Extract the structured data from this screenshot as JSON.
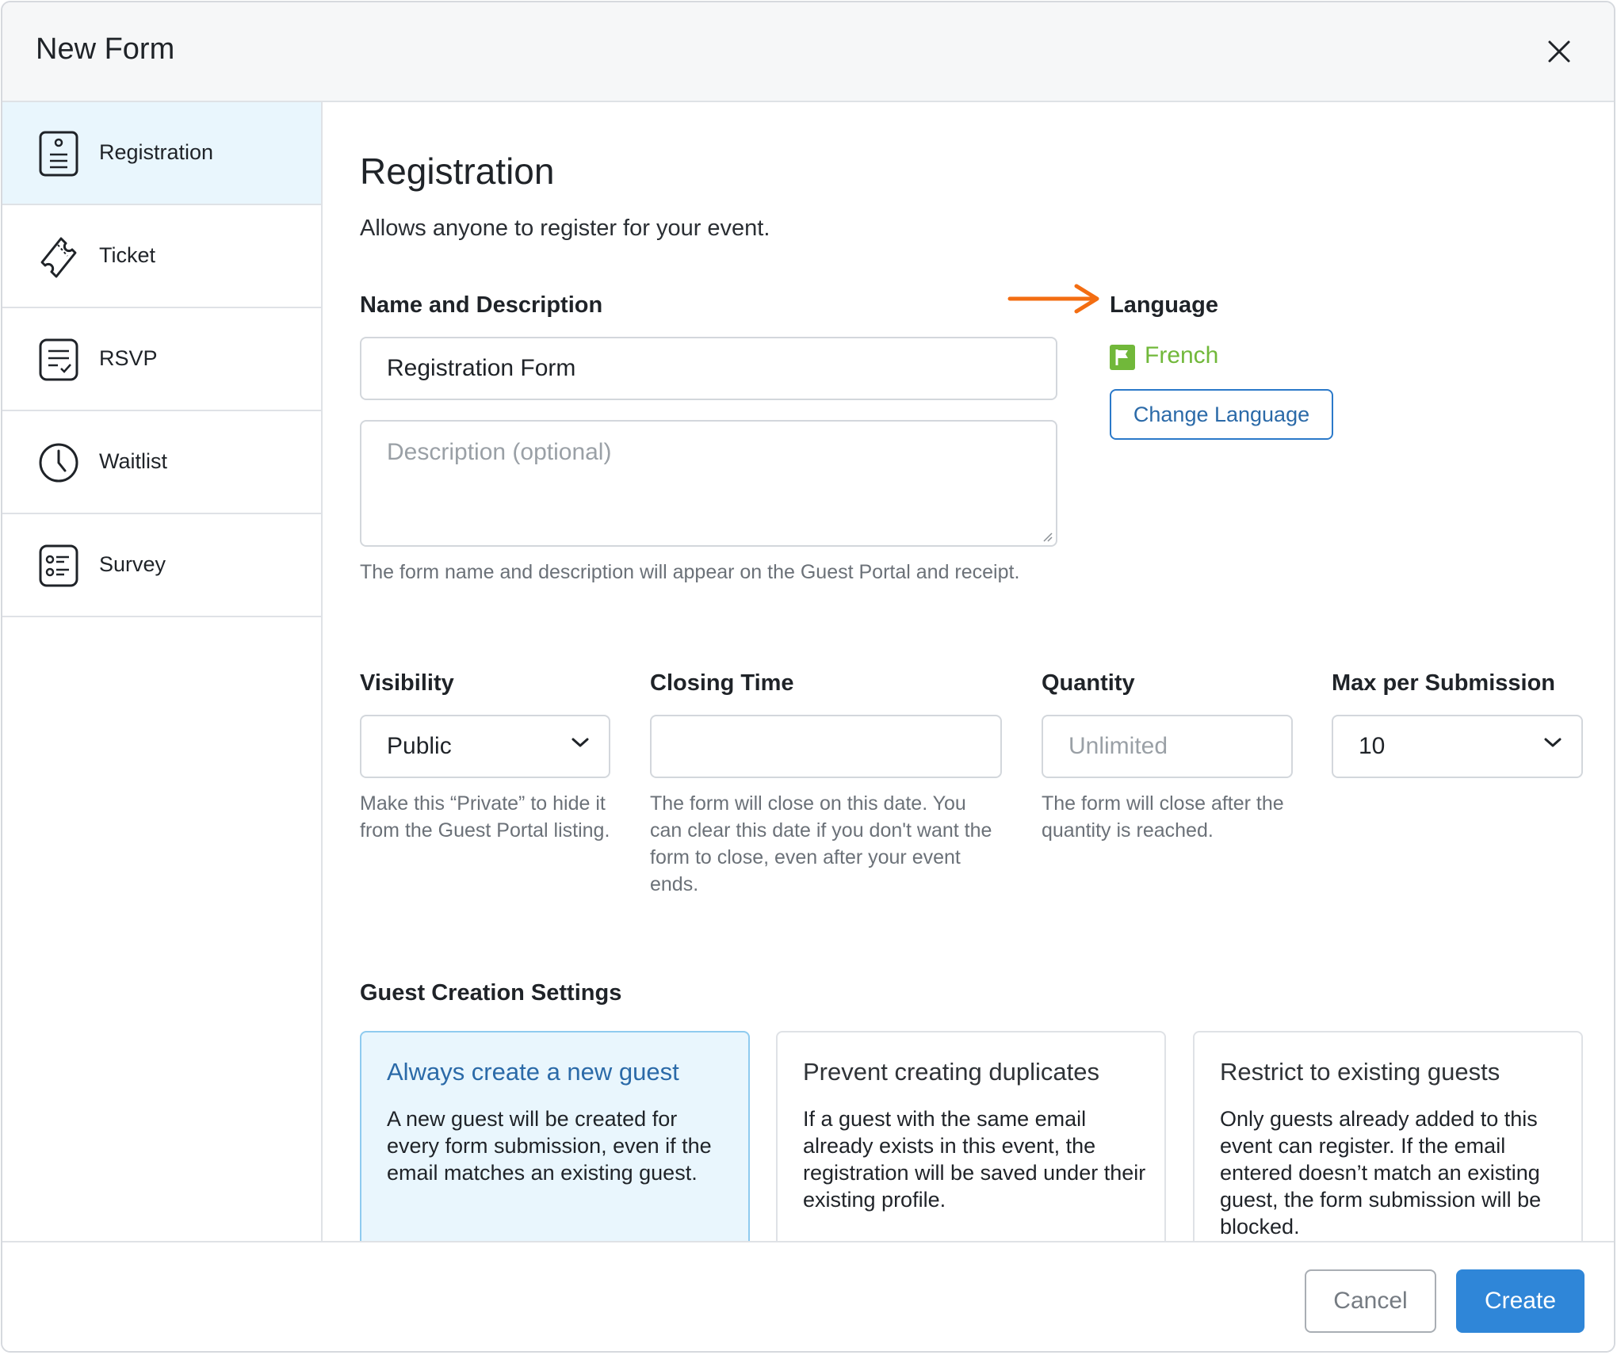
{
  "dialog": {
    "title": "New Form"
  },
  "sidebar": {
    "items": [
      {
        "label": "Registration",
        "icon": "registration-form-icon",
        "active": true
      },
      {
        "label": "Ticket",
        "icon": "ticket-icon",
        "active": false
      },
      {
        "label": "RSVP",
        "icon": "rsvp-checklist-icon",
        "active": false
      },
      {
        "label": "Waitlist",
        "icon": "clock-icon",
        "active": false
      },
      {
        "label": "Survey",
        "icon": "survey-list-icon",
        "active": false
      }
    ]
  },
  "main": {
    "title": "Registration",
    "subtitle": "Allows anyone to register for your event.",
    "name_desc": {
      "label": "Name and Description",
      "name_value": "Registration Form",
      "description_placeholder": "Description (optional)",
      "help": "The form name and description will appear on the Guest Portal and receipt."
    },
    "language": {
      "label": "Language",
      "value": "French",
      "change_button": "Change Language"
    },
    "visibility": {
      "label": "Visibility",
      "value": "Public",
      "help": "Make this “Private” to hide it from the Guest Portal listing."
    },
    "closing_time": {
      "label": "Closing Time",
      "value": "",
      "help": "The form will close on this date. You can clear this date if you don't want the form to close, even after your event ends."
    },
    "quantity": {
      "label": "Quantity",
      "placeholder": "Unlimited",
      "help": "The form will close after the quantity is reached."
    },
    "max_per_submission": {
      "label": "Max per Submission",
      "value": "10"
    },
    "guest_creation": {
      "label": "Guest Creation Settings",
      "options": [
        {
          "title": "Always create a new guest",
          "description": "A new guest will be created for every form submission, even if the email matches an existing guest.",
          "selected": true
        },
        {
          "title": "Prevent creating duplicates",
          "description": "If a guest with the same email already exists in this event, the registration will be saved under their existing profile.",
          "selected": false
        },
        {
          "title": "Restrict to existing guests",
          "description": "Only guests already added to this event can register. If the email entered doesn’t match an existing guest, the form submission will be blocked.",
          "selected": false
        }
      ]
    }
  },
  "footer": {
    "cancel_label": "Cancel",
    "create_label": "Create"
  },
  "colors": {
    "accent": "#2f86d8",
    "active_bg": "#e9f6fd",
    "language_green": "#71b83a",
    "annotation_arrow": "#f36d12"
  }
}
